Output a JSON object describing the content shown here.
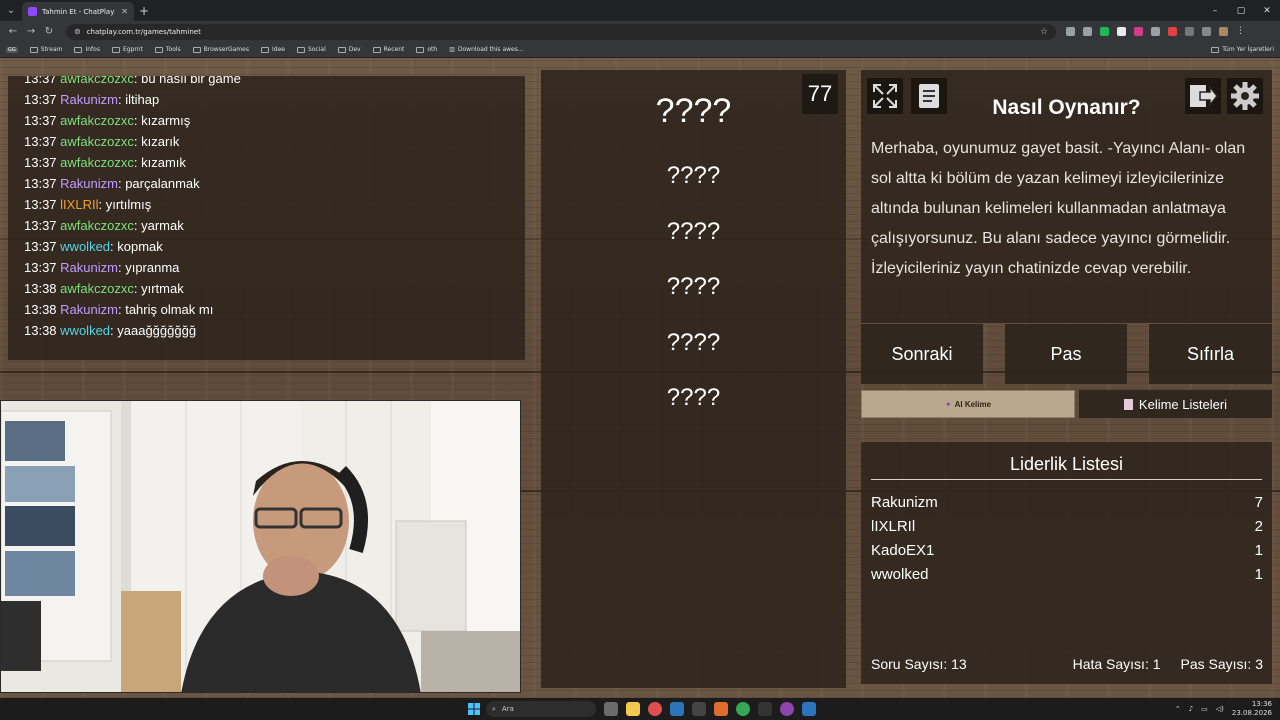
{
  "browser": {
    "tab_title": "Tahmin Et - ChatPlay",
    "url": "chatplay.com.tr/games/tahminet",
    "bookmarks": [
      "Stream",
      "Infos",
      "Egprnt",
      "Tools",
      "BrowserGames",
      "Idee",
      "Social",
      "Dev",
      "Recent",
      "oth",
      "Download this awes..."
    ],
    "all_bookmarks": "Tüm Yer İşaretleri"
  },
  "chat": {
    "messages": [
      {
        "time": "13:37",
        "user": "awfakczozxc",
        "text": "bu nasıl bir game",
        "color": "#7be07b"
      },
      {
        "time": "13:37",
        "user": "Rakunizm",
        "text": "iltihap",
        "color": "#c39bff"
      },
      {
        "time": "13:37",
        "user": "awfakczozxc",
        "text": "kızarmış",
        "color": "#7be07b"
      },
      {
        "time": "13:37",
        "user": "awfakczozxc",
        "text": "kızarık",
        "color": "#7be07b"
      },
      {
        "time": "13:37",
        "user": "awfakczozxc",
        "text": "kızamık",
        "color": "#7be07b"
      },
      {
        "time": "13:37",
        "user": "Rakunizm",
        "text": "parçalanmak",
        "color": "#c39bff"
      },
      {
        "time": "13:37",
        "user": "lIXLRIl",
        "text": "yırtılmış",
        "color": "#f0a030"
      },
      {
        "time": "13:37",
        "user": "awfakczozxc",
        "text": "yarmak",
        "color": "#7be07b"
      },
      {
        "time": "13:37",
        "user": "wwolked",
        "text": "kopmak",
        "color": "#4fd6e6"
      },
      {
        "time": "13:37",
        "user": "Rakunizm",
        "text": "yıpranma",
        "color": "#c39bff"
      },
      {
        "time": "13:38",
        "user": "awfakczozxc",
        "text": "yırtmak",
        "color": "#7be07b"
      },
      {
        "time": "13:38",
        "user": "Rakunizm",
        "text": "tahriş olmak mı",
        "color": "#c39bff"
      },
      {
        "time": "13:38",
        "user": "wwolked",
        "text": "yaaağğğğğğğ",
        "color": "#4fd6e6"
      }
    ]
  },
  "game": {
    "counter": "77",
    "main_word": "????",
    "forbidden_words": [
      "????",
      "????",
      "????",
      "????",
      "????"
    ]
  },
  "howto": {
    "title": "Nasıl Oynanır?",
    "text": "Merhaba, oyunumuz gayet basit. -Yayıncı Alanı- olan sol altta ki bölüm de yazan kelimeyi izleyicilerinize altında bulunan kelimeleri kullanmadan anlatmaya çalışıyorsunuz. Bu alanı sadece yayıncı görmelidir. İzleyicileriniz yayın chatinizde cevap verebilir."
  },
  "actions": {
    "next": "Sonraki",
    "pass": "Pas",
    "reset": "Sıfırla",
    "ai_word": "AI Kelime",
    "word_lists": "Kelime Listeleri"
  },
  "leaderboard": {
    "title": "Liderlik Listesi",
    "rows": [
      {
        "name": "Rakunizm",
        "score": "7"
      },
      {
        "name": "lIXLRIl",
        "score": "2"
      },
      {
        "name": "KadoEX1",
        "score": "1"
      },
      {
        "name": "wwolked",
        "score": "1"
      }
    ],
    "question_count": "Soru Sayısı: 13",
    "error_count": "Hata Sayısı: 1",
    "pass_count": "Pas Sayısı: 3"
  },
  "taskbar": {
    "search": "Ara",
    "time": "13:36",
    "date": "23.08.2026"
  }
}
